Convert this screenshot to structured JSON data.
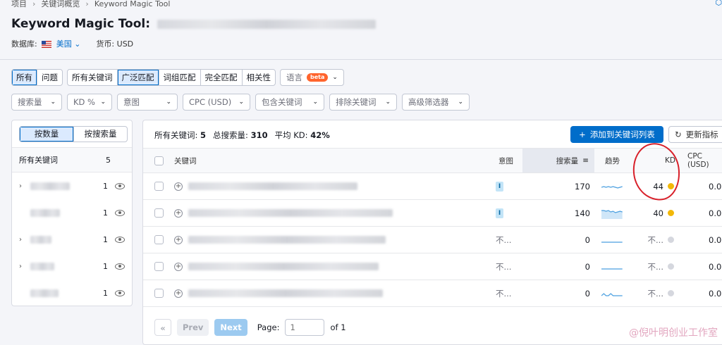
{
  "breadcrumb": [
    "项目",
    "关键词概览",
    "Keyword Magic Tool"
  ],
  "header": {
    "title": "Keyword Magic Tool:",
    "database_label": "数据库:",
    "database_value": "美国",
    "currency": "货币: USD"
  },
  "filters_row1": {
    "intent_tabs": [
      {
        "label": "所有",
        "active": true
      },
      {
        "label": "问题",
        "active": false
      }
    ],
    "match_tabs": [
      {
        "label": "所有关键词",
        "active": false
      },
      {
        "label": "广泛匹配",
        "active": true
      },
      {
        "label": "词组匹配",
        "active": false
      },
      {
        "label": "完全匹配",
        "active": false
      },
      {
        "label": "相关性",
        "active": false
      }
    ],
    "language": {
      "label": "语言",
      "badge": "beta"
    }
  },
  "filters_row2": [
    "搜索量",
    "KD %",
    "意图",
    "CPC (USD)",
    "包含关键词",
    "排除关键词",
    "高级筛选器"
  ],
  "left_panel": {
    "toggle": [
      {
        "label": "按数量",
        "active": true
      },
      {
        "label": "按搜索量",
        "active": false
      }
    ],
    "header": {
      "label": "所有关键词",
      "count": "5"
    },
    "groups": [
      {
        "has_arrow": true,
        "count": "1"
      },
      {
        "has_arrow": false,
        "count": "1"
      },
      {
        "has_arrow": true,
        "count": "1"
      },
      {
        "has_arrow": true,
        "count": "1"
      },
      {
        "has_arrow": false,
        "count": "1"
      }
    ]
  },
  "summary": {
    "all_label": "所有关键词:",
    "all_value": "5",
    "volume_label": "总搜索量:",
    "volume_value": "310",
    "kd_label": "平均 KD:",
    "kd_value": "42%"
  },
  "actions": {
    "add_label": "添加到关键词列表",
    "refresh_label": "更新指标"
  },
  "columns": {
    "keyword": "关键词",
    "intent": "意图",
    "volume": "搜索量",
    "trend": "趋势",
    "kd": "KD",
    "cpc": "CPC (USD)"
  },
  "rows": [
    {
      "intent": "I",
      "volume": "170",
      "kd": "44",
      "kd_color": "#f2b807",
      "cpc": "0.0",
      "trend": [
        5,
        6,
        5,
        6,
        5,
        6,
        5,
        4,
        5,
        6
      ]
    },
    {
      "intent": "I",
      "volume": "140",
      "kd": "40",
      "kd_color": "#f2b807",
      "cpc": "0.0",
      "trend": [
        10,
        10,
        9,
        10,
        8,
        9,
        7,
        8,
        9,
        8
      ]
    },
    {
      "intent": "不...",
      "volume": "0",
      "kd": "不...",
      "kd_color": "#d5d7de",
      "cpc": "0.0",
      "trend": [
        3,
        3,
        3,
        3,
        3,
        3,
        3,
        3,
        3,
        3
      ]
    },
    {
      "intent": "不...",
      "volume": "0",
      "kd": "不...",
      "kd_color": "#d5d7de",
      "cpc": "0.0",
      "trend": [
        3,
        3,
        3,
        3,
        3,
        3,
        3,
        3,
        3,
        3
      ]
    },
    {
      "intent": "不...",
      "volume": "0",
      "kd": "不...",
      "kd_color": "#d5d7de",
      "cpc": "0.0",
      "trend": [
        3,
        6,
        3,
        3,
        6,
        3,
        3,
        3,
        3,
        3
      ]
    }
  ],
  "pagination": {
    "prev": "Prev",
    "next": "Next",
    "page_label": "Page:",
    "page_placeholder": "1",
    "of_label": "of 1"
  },
  "watermark": "@倪叶明创业工作室",
  "colors": {
    "accent": "#006dca",
    "annotation": "#d8202a"
  }
}
